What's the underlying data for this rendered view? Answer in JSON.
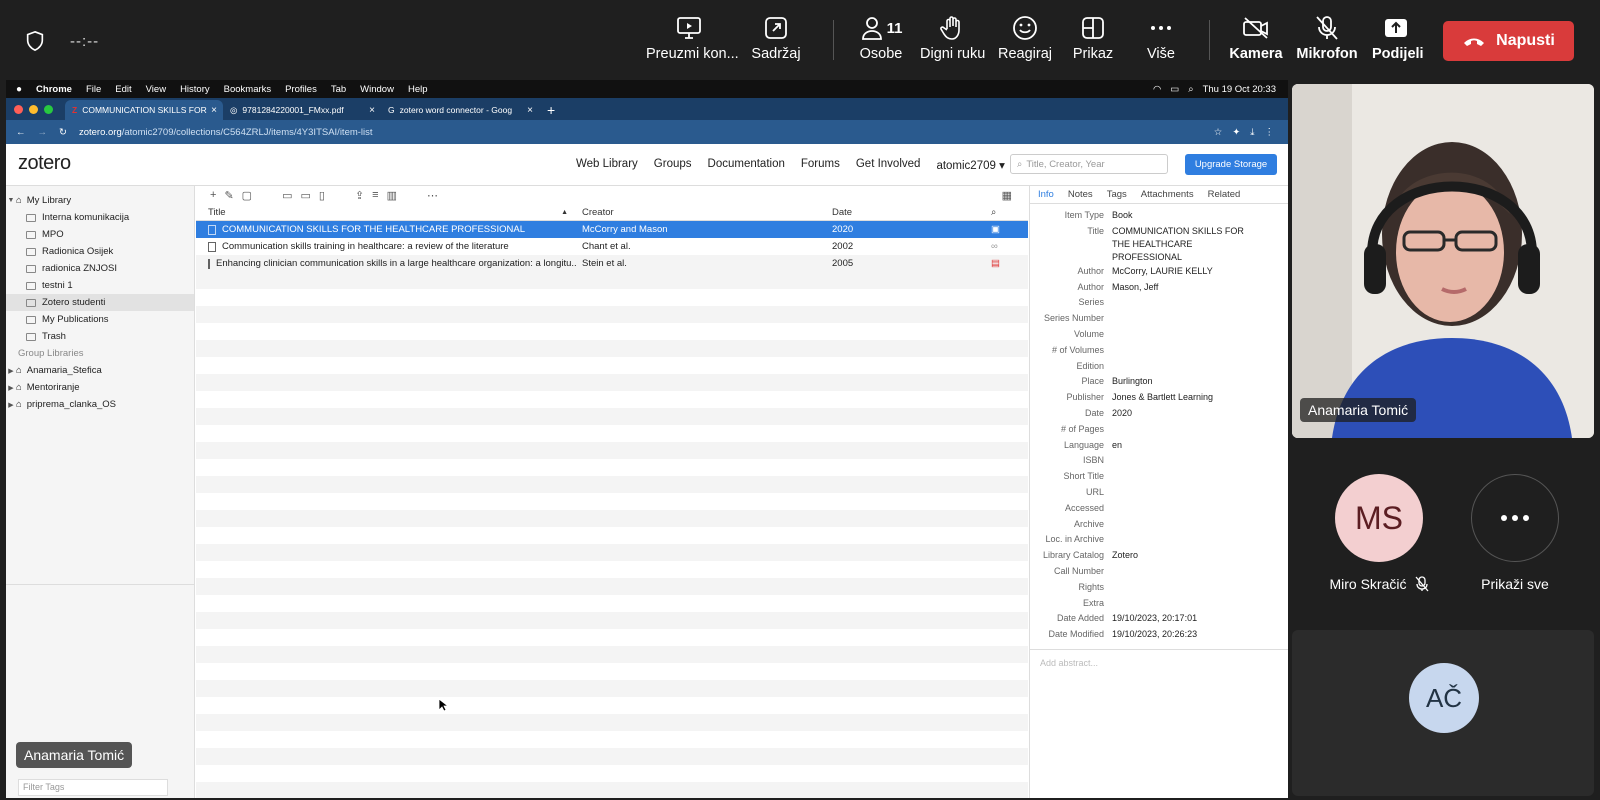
{
  "meeting": {
    "timer": "--:--",
    "buttons": [
      {
        "label": "Preuzmi kon..."
      },
      {
        "label": "Sadržaj"
      },
      {
        "label": "Osobe",
        "count": "11"
      },
      {
        "label": "Digni ruku"
      },
      {
        "label": "Reagiraj"
      },
      {
        "label": "Prikaz"
      },
      {
        "label": "Više"
      },
      {
        "label": "Kamera"
      },
      {
        "label": "Mikrofon"
      },
      {
        "label": "Podijeli"
      }
    ],
    "leave_label": "Napusti",
    "colors": {
      "leave": "#d93b3b",
      "background": "#1f1f1f"
    }
  },
  "mac_menu": {
    "apple": "",
    "app": "Chrome",
    "items": [
      "File",
      "Edit",
      "View",
      "History",
      "Bookmarks",
      "Profiles",
      "Tab",
      "Window",
      "Help"
    ],
    "clock": "Thu 19 Oct  20:33"
  },
  "browser": {
    "tabs": [
      {
        "label": "COMMUNICATION SKILLS FOR",
        "icon": "zotero-icon"
      },
      {
        "label": "9781284220001_FMxx.pdf",
        "icon": "globe-icon"
      },
      {
        "label": "zotero word connector - Goog",
        "icon": "google-icon"
      }
    ],
    "url_host": "zotero.org",
    "url_path": "/atomic2709/collections/C564ZRLJ/items/4Y3ITSAI/item-list"
  },
  "zotero": {
    "logo": "zotero",
    "nav": [
      "Web Library",
      "Groups",
      "Documentation",
      "Forums",
      "Get Involved",
      "atomic2709"
    ],
    "search_placeholder": "Title, Creator, Year",
    "upgrade_label": "Upgrade Storage",
    "library": {
      "my_library": "My Library",
      "collections": [
        "Interna komunikacija",
        "MPO",
        "Radionica Osijek",
        "radionica ZNJOSI",
        "testni 1",
        "Zotero studenti",
        "My Publications",
        "Trash"
      ],
      "group_header": "Group Libraries",
      "groups": [
        "Anamaria_Stefica",
        "Mentoriranje",
        "priprema_clanka_OS"
      ],
      "filter_placeholder": "Filter Tags"
    },
    "columns": {
      "title": "Title",
      "creator": "Creator",
      "date": "Date"
    },
    "items": [
      {
        "title": "COMMUNICATION SKILLS FOR THE HEALTHCARE PROFESSIONAL",
        "creator": "McCorry and Mason",
        "date": "2020"
      },
      {
        "title": "Communication skills training in healthcare: a review of the literature",
        "creator": "Chant et al.",
        "date": "2002"
      },
      {
        "title": "Enhancing clinician communication skills in a large healthcare organization: a longitu...",
        "creator": "Stein et al.",
        "date": "2005"
      }
    ],
    "info_tabs": [
      "Info",
      "Notes",
      "Tags",
      "Attachments",
      "Related"
    ],
    "fields": [
      {
        "k": "Item Type",
        "v": "Book"
      },
      {
        "k": "Title",
        "v": "COMMUNICATION SKILLS FOR THE HEALTHCARE PROFESSIONAL"
      },
      {
        "k": "Author",
        "v": "McCorry, LAURIE KELLY"
      },
      {
        "k": "Author",
        "v": "Mason, Jeff"
      },
      {
        "k": "Series",
        "v": ""
      },
      {
        "k": "Series Number",
        "v": ""
      },
      {
        "k": "Volume",
        "v": ""
      },
      {
        "k": "# of Volumes",
        "v": ""
      },
      {
        "k": "Edition",
        "v": ""
      },
      {
        "k": "Place",
        "v": "Burlington"
      },
      {
        "k": "Publisher",
        "v": "Jones & Bartlett Learning"
      },
      {
        "k": "Date",
        "v": "2020"
      },
      {
        "k": "# of Pages",
        "v": ""
      },
      {
        "k": "Language",
        "v": "en"
      },
      {
        "k": "ISBN",
        "v": ""
      },
      {
        "k": "Short Title",
        "v": ""
      },
      {
        "k": "URL",
        "v": ""
      },
      {
        "k": "Accessed",
        "v": ""
      },
      {
        "k": "Archive",
        "v": ""
      },
      {
        "k": "Loc. in Archive",
        "v": ""
      },
      {
        "k": "Library Catalog",
        "v": "Zotero"
      },
      {
        "k": "Call Number",
        "v": ""
      },
      {
        "k": "Rights",
        "v": ""
      },
      {
        "k": "Extra",
        "v": ""
      },
      {
        "k": "Date Added",
        "v": "19/10/2023, 20:17:01"
      },
      {
        "k": "Date Modified",
        "v": "19/10/2023, 20:26:23"
      }
    ],
    "abstract_placeholder": "Add abstract..."
  },
  "participants": {
    "video_name": "Anamaria Tomić",
    "ms_initials": "MS",
    "ms_name": "Miro Skračić",
    "show_all": "Prikaži sve",
    "ac_initials": "AČ",
    "presenter_badge": "Anamaria Tomić"
  }
}
